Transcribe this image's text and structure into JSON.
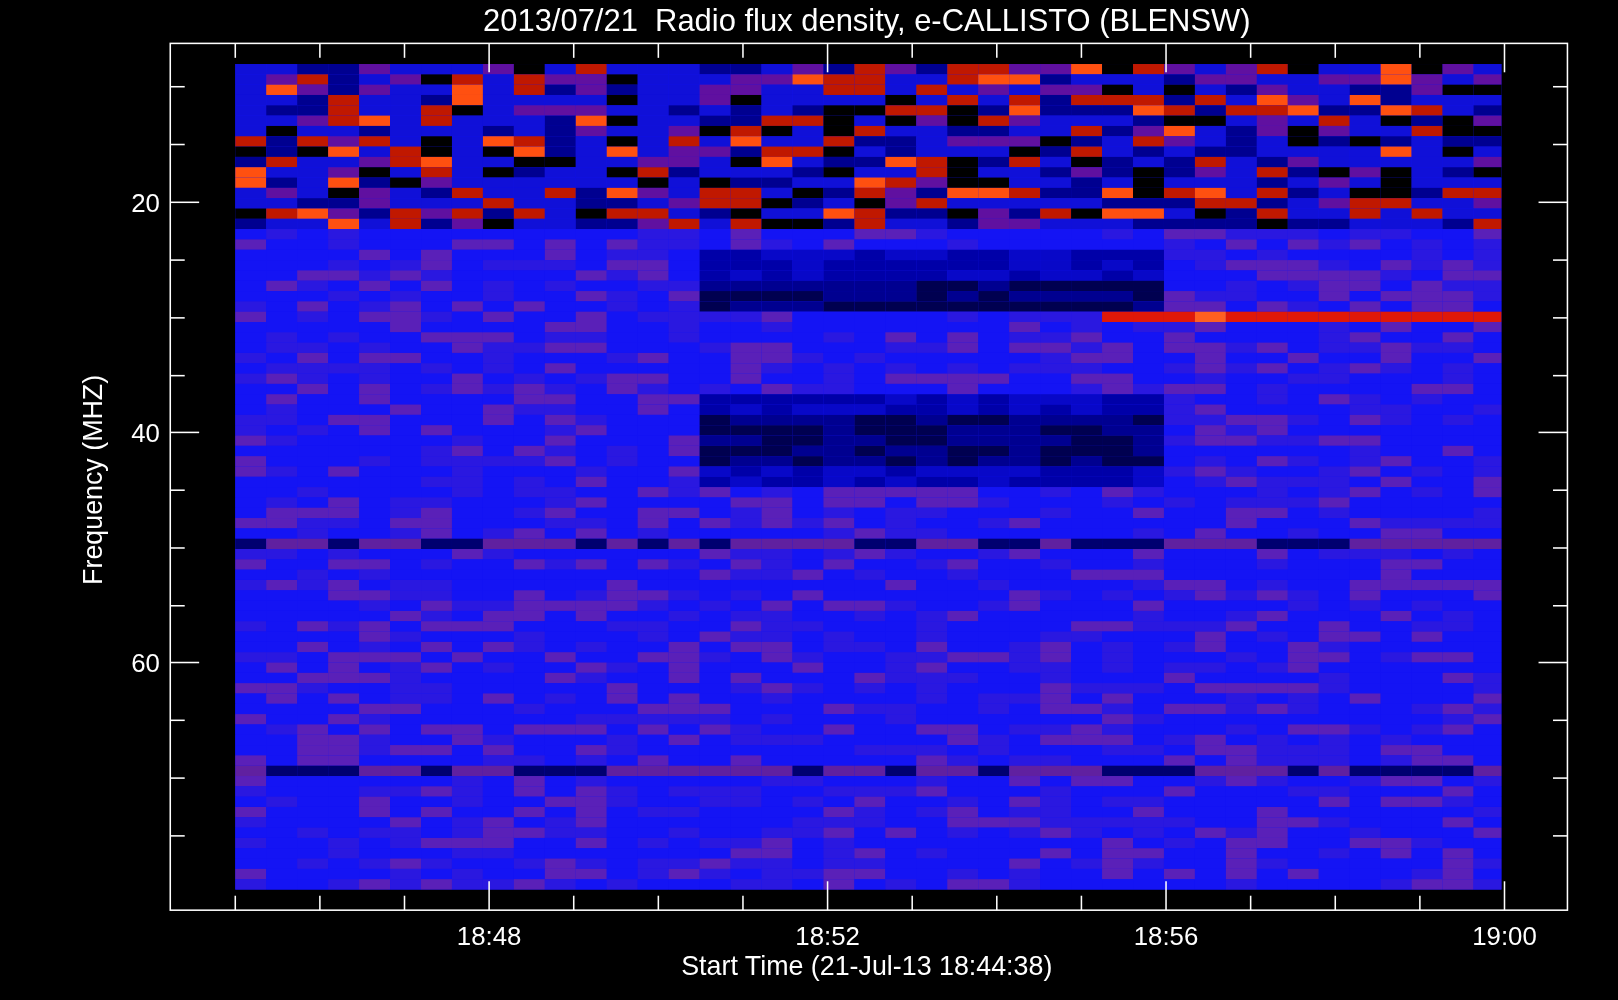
{
  "title": "2013/07/21  Radio flux density, e-CALLISTO (BLENSW)",
  "ylabel": "Frequency (MHZ)",
  "yticks": [
    "20",
    "40",
    "60"
  ],
  "xticks": [
    "18:48",
    "18:52",
    "18:56",
    "19:00"
  ],
  "xlabel": "Start Time (21-Jul-13 18:44:38)"
}
